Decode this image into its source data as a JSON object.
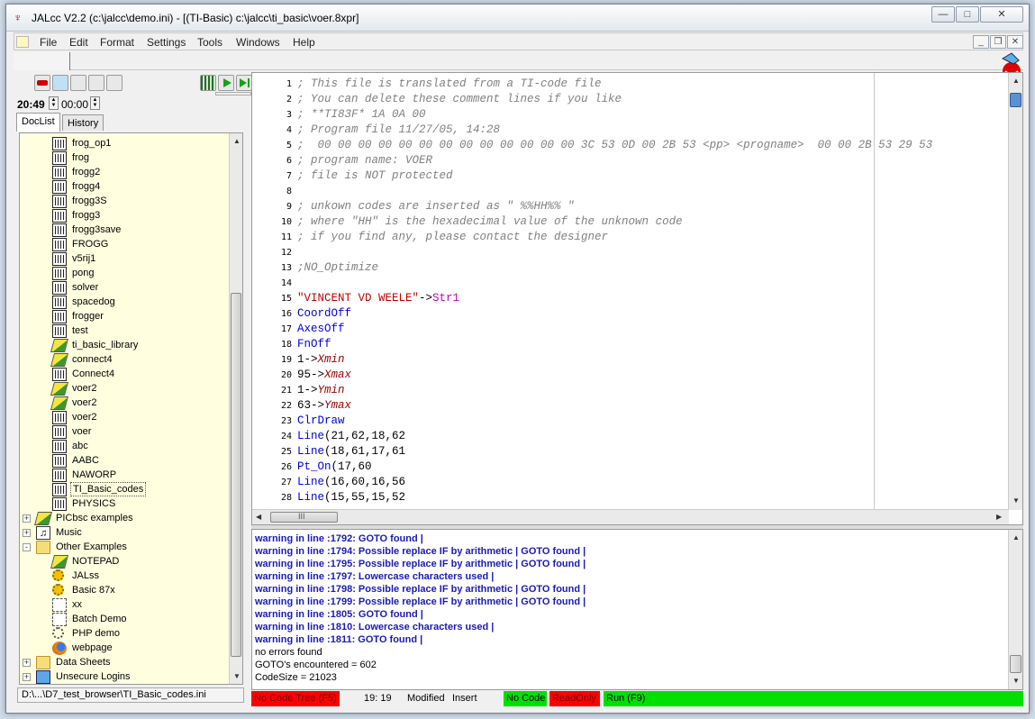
{
  "window": {
    "title": "JALcc V2.2   (c:\\jalcc\\demo.ini) - [(TI-Basic) c:\\jalcc\\ti_basic\\voer.8xpr]"
  },
  "menu": [
    "File",
    "Edit",
    "Format",
    "Settings",
    "Tools",
    "Windows",
    "Help"
  ],
  "toolbar": {
    "time_hours": "20:49",
    "time_minutes": "00:00"
  },
  "doctabs": [
    "DocList",
    "History"
  ],
  "tree": {
    "items": [
      {
        "label": "frog_op1",
        "icon": "ti-program-icon",
        "level": 2
      },
      {
        "label": "frog",
        "icon": "ti-program-icon",
        "level": 2
      },
      {
        "label": "frogg2",
        "icon": "ti-program-icon",
        "level": 2
      },
      {
        "label": "frogg4",
        "icon": "ti-program-icon",
        "level": 2
      },
      {
        "label": "frogg3S",
        "icon": "ti-program-icon",
        "level": 2
      },
      {
        "label": "frogg3",
        "icon": "ti-program-icon",
        "level": 2
      },
      {
        "label": "frogg3save",
        "icon": "ti-program-icon",
        "level": 2
      },
      {
        "label": "FROGG",
        "icon": "ti-program-icon",
        "level": 2
      },
      {
        "label": "v5rij1",
        "icon": "ti-program-icon",
        "level": 2
      },
      {
        "label": "pong",
        "icon": "ti-program-icon",
        "level": 2
      },
      {
        "label": "solver",
        "icon": "ti-program-icon",
        "level": 2
      },
      {
        "label": "spacedog",
        "icon": "ti-program-icon",
        "level": 2
      },
      {
        "label": "frogger",
        "icon": "ti-program-icon",
        "level": 2
      },
      {
        "label": "test",
        "icon": "ti-program-icon",
        "level": 2
      },
      {
        "label": "ti_basic_library",
        "icon": "book-icon",
        "level": 2
      },
      {
        "label": "connect4",
        "icon": "book-icon",
        "level": 2
      },
      {
        "label": "Connect4",
        "icon": "ti-program-icon",
        "level": 2
      },
      {
        "label": "voer2",
        "icon": "book-icon",
        "level": 2
      },
      {
        "label": "voer2",
        "icon": "book-icon",
        "level": 2
      },
      {
        "label": "voer2",
        "icon": "ti-program-icon",
        "level": 2
      },
      {
        "label": "voer",
        "icon": "ti-program-icon",
        "level": 2
      },
      {
        "label": "abc",
        "icon": "ti-program-icon",
        "level": 2
      },
      {
        "label": "AABC",
        "icon": "ti-program-icon",
        "level": 2
      },
      {
        "label": "NAWORP",
        "icon": "ti-program-icon",
        "level": 2
      },
      {
        "label": "TI_Basic_codes",
        "icon": "ti-program-icon",
        "level": 2,
        "selected": true
      },
      {
        "label": "PHYSICS",
        "icon": "ti-program-icon",
        "level": 2
      },
      {
        "label": "PICbsc examples",
        "icon": "book-icon",
        "level": 1,
        "expand": "+"
      },
      {
        "label": "Music",
        "icon": "music-icon",
        "level": 1,
        "expand": "+"
      },
      {
        "label": "Other Examples",
        "icon": "folder-icon",
        "level": 1,
        "expand": "-"
      },
      {
        "label": "NOTEPAD",
        "icon": "book-icon",
        "level": 2
      },
      {
        "label": "JALss",
        "icon": "gear-icon",
        "level": 2
      },
      {
        "label": "Basic 87x",
        "icon": "gear-icon",
        "level": 2
      },
      {
        "label": "xx",
        "icon": "exe-icon",
        "level": 2
      },
      {
        "label": "Batch Demo",
        "icon": "exe-icon",
        "level": 2
      },
      {
        "label": "PHP demo",
        "icon": "php-icon",
        "level": 2
      },
      {
        "label": "webpage",
        "icon": "firefox-icon",
        "level": 2
      },
      {
        "label": "Data Sheets",
        "icon": "folder-icon",
        "level": 1,
        "expand": "+"
      },
      {
        "label": "Unsecure Logins",
        "icon": "lock-icon",
        "level": 1,
        "expand": "+"
      }
    ]
  },
  "path": "D:\\...\\D7_test_browser\\TI_Basic_codes.ini",
  "editor": {
    "lines": [
      {
        "n": "1",
        "segs": [
          {
            "t": "; This file is translated from a TI-code file",
            "c": "cmt"
          }
        ]
      },
      {
        "n": "2",
        "segs": [
          {
            "t": "; You can delete these comment lines if you like",
            "c": "cmt"
          }
        ]
      },
      {
        "n": "3",
        "segs": [
          {
            "t": "; **TI83F* 1A 0A 00",
            "c": "cmt"
          }
        ]
      },
      {
        "n": "4",
        "segs": [
          {
            "t": "; Program file 11/27/05, 14:28",
            "c": "cmt"
          }
        ]
      },
      {
        "n": "5",
        "segs": [
          {
            "t": ";  00 00 00 00 00 00 00 00 00 00 00 00 00 3C 53 0D 00 2B 53 <pp> <progname>  00 00 2B 53 29 53",
            "c": "cmt"
          }
        ]
      },
      {
        "n": "6",
        "segs": [
          {
            "t": "; program name: VOER",
            "c": "cmt"
          }
        ]
      },
      {
        "n": "7",
        "segs": [
          {
            "t": "; file is NOT protected",
            "c": "cmt"
          }
        ]
      },
      {
        "n": "8",
        "segs": []
      },
      {
        "n": "9",
        "segs": [
          {
            "t": "; unkown codes are inserted as \" %%HH%% \"",
            "c": "cmt"
          }
        ]
      },
      {
        "n": "10",
        "segs": [
          {
            "t": "; where \"HH\" is the hexadecimal value of the unknown code",
            "c": "cmt"
          }
        ]
      },
      {
        "n": "11",
        "segs": [
          {
            "t": "; if you find any, please contact the designer",
            "c": "cmt"
          }
        ]
      },
      {
        "n": "12",
        "segs": []
      },
      {
        "n": "13",
        "segs": [
          {
            "t": ";NO_Optimize",
            "c": "cmt"
          }
        ]
      },
      {
        "n": "14",
        "segs": []
      },
      {
        "n": "15",
        "segs": [
          {
            "t": "\"VINCENT VD WEELE\"",
            "c": "str"
          },
          {
            "t": "->",
            "c": ""
          },
          {
            "t": "Str1",
            "c": "var"
          }
        ]
      },
      {
        "n": "16",
        "segs": [
          {
            "t": "CoordOff",
            "c": "kw"
          }
        ]
      },
      {
        "n": "17",
        "segs": [
          {
            "t": "AxesOff",
            "c": "kw"
          }
        ]
      },
      {
        "n": "18",
        "segs": [
          {
            "t": "FnOff",
            "c": "kw"
          }
        ]
      },
      {
        "n": "19",
        "segs": [
          {
            "t": "1->",
            "c": ""
          },
          {
            "t": "Xmin",
            "c": "sysv"
          }
        ]
      },
      {
        "n": "20",
        "segs": [
          {
            "t": "95->",
            "c": ""
          },
          {
            "t": "Xmax",
            "c": "sysv"
          }
        ]
      },
      {
        "n": "21",
        "segs": [
          {
            "t": "1->",
            "c": ""
          },
          {
            "t": "Ymin",
            "c": "sysv"
          }
        ]
      },
      {
        "n": "22",
        "segs": [
          {
            "t": "63->",
            "c": ""
          },
          {
            "t": "Ymax",
            "c": "sysv"
          }
        ]
      },
      {
        "n": "23",
        "segs": [
          {
            "t": "ClrDraw",
            "c": "kw"
          }
        ]
      },
      {
        "n": "24",
        "segs": [
          {
            "t": "Line",
            "c": "kw"
          },
          {
            "t": "(21,62,18,62",
            "c": ""
          }
        ]
      },
      {
        "n": "25",
        "segs": [
          {
            "t": "Line",
            "c": "kw"
          },
          {
            "t": "(18,61,17,61",
            "c": ""
          }
        ]
      },
      {
        "n": "26",
        "segs": [
          {
            "t": "Pt_On",
            "c": "kw"
          },
          {
            "t": "(17,60",
            "c": ""
          }
        ]
      },
      {
        "n": "27",
        "segs": [
          {
            "t": "Line",
            "c": "kw"
          },
          {
            "t": "(16,60,16,56",
            "c": ""
          }
        ]
      },
      {
        "n": "28",
        "segs": [
          {
            "t": "Line",
            "c": "kw"
          },
          {
            "t": "(15,55,15,52",
            "c": ""
          }
        ]
      }
    ]
  },
  "output": {
    "lines": [
      {
        "t": "warning in line :1792: GOTO found |",
        "c": "warn"
      },
      {
        "t": "warning in line :1794: Possible replace IF by arithmetic | GOTO found |",
        "c": "warn"
      },
      {
        "t": "warning in line :1795: Possible replace IF by arithmetic | GOTO found |",
        "c": "warn"
      },
      {
        "t": "warning in line :1797: Lowercase characters used |",
        "c": "warn"
      },
      {
        "t": "warning in line :1798: Possible replace IF by arithmetic | GOTO found |",
        "c": "warn"
      },
      {
        "t": "warning in line :1799: Possible replace IF by arithmetic | GOTO found |",
        "c": "warn"
      },
      {
        "t": "warning in line :1805: GOTO found |",
        "c": "warn"
      },
      {
        "t": "warning in line :1810: Lowercase characters used |",
        "c": "warn"
      },
      {
        "t": "warning in line :1811: GOTO found |",
        "c": "warn"
      },
      {
        "t": "no errors found",
        "c": ""
      },
      {
        "t": "GOTO's encountered = 602",
        "c": ""
      },
      {
        "t": "CodeSize = 21023",
        "c": ""
      }
    ]
  },
  "status": {
    "code_tree": "No Code Tree (F5)",
    "cursor": "19: 19",
    "modified": "Modified",
    "insert": "Insert",
    "no_code": "No Code",
    "readonly": "ReadOnly",
    "run": "Run (F9)",
    "colors": {
      "red": "#ff0000",
      "green": "#00e000"
    }
  },
  "hscroll_grip": "III"
}
